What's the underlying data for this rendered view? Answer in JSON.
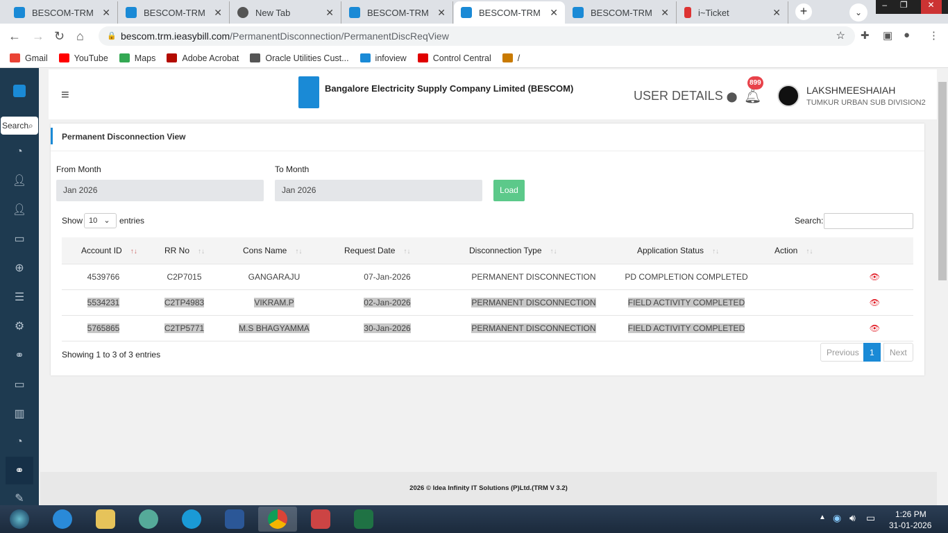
{
  "browser": {
    "tabs": [
      {
        "title": "BESCOM-TRM",
        "icon": "bescom"
      },
      {
        "title": "BESCOM-TRM",
        "icon": "bescom"
      },
      {
        "title": "New Tab",
        "icon": "chrome"
      },
      {
        "title": "BESCOM-TRM",
        "icon": "bescom"
      },
      {
        "title": "BESCOM-TRM",
        "icon": "bescom",
        "active": true
      },
      {
        "title": "BESCOM-TRM",
        "icon": "bescom"
      },
      {
        "title": "i~Ticket",
        "icon": "iticket"
      }
    ],
    "url_host": "bescom.trm.ieasybill.com",
    "url_path": "/PermanentDisconnection/PermanentDiscReqView",
    "bookmarks": [
      {
        "label": "Gmail",
        "color": "#ea4335"
      },
      {
        "label": "YouTube",
        "color": "#ff0000"
      },
      {
        "label": "Maps",
        "color": "#34a853"
      },
      {
        "label": "Adobe Acrobat",
        "color": "#b30b00"
      },
      {
        "label": "Oracle Utilities Cust...",
        "color": "#555555"
      },
      {
        "label": "infoview",
        "color": "#1a8ad6"
      },
      {
        "label": "Control Central",
        "color": "#e00000"
      },
      {
        "label": "/",
        "color": "#c97a00"
      }
    ]
  },
  "sidebar": {
    "search_label": "Search"
  },
  "header": {
    "company": "Bangalore Electricity Supply Company Limited (BESCOM)",
    "user_details": "USER DETAILS",
    "notif_count": "899",
    "user_name": "LAKSHMEESHAIAH",
    "user_office": "TUMKUR URBAN SUB DIVISION2"
  },
  "page": {
    "title": "Permanent Disconnection View",
    "from_label": "From Month",
    "from_value": "Jan 2026",
    "to_label": "To Month",
    "to_value": "Jan 2026",
    "load": "Load",
    "show": "Show",
    "entries_value": "10",
    "entries": "entries",
    "search_label": "Search:",
    "columns": [
      "Account ID",
      "RR No",
      "Cons Name",
      "Request Date",
      "Disconnection Type",
      "Application Status",
      "Action"
    ],
    "rows": [
      [
        "4539766",
        "C2P7015",
        "GANGARAJU",
        "07-Jan-2026",
        "PERMANENT DISCONNECTION",
        "PD COMPLETION COMPLETED"
      ],
      [
        "5534231",
        "C2TP4983",
        "VIKRAM.P",
        "02-Jan-2026",
        "PERMANENT DISCONNECTION",
        "FIELD ACTIVITY COMPLETED"
      ],
      [
        "5765865",
        "C2TP5771",
        "M.S BHAGYAMMA",
        "30-Jan-2026",
        "PERMANENT DISCONNECTION",
        "FIELD ACTIVITY COMPLETED"
      ]
    ],
    "info": "Showing 1 to 3 of 3 entries",
    "prev": "Previous",
    "page_num": "1",
    "next": "Next"
  },
  "footer": "2026 © Idea Infinity IT Solutions (P)Ltd.(TRM V 3.2)",
  "taskbar": {
    "time": "1:26 PM",
    "date": "31-01-2026"
  },
  "colors": {
    "accent": "#1a8ad6",
    "load": "#5cc98a",
    "sidebar": "#1e3a50",
    "badge": "#e8424a"
  }
}
